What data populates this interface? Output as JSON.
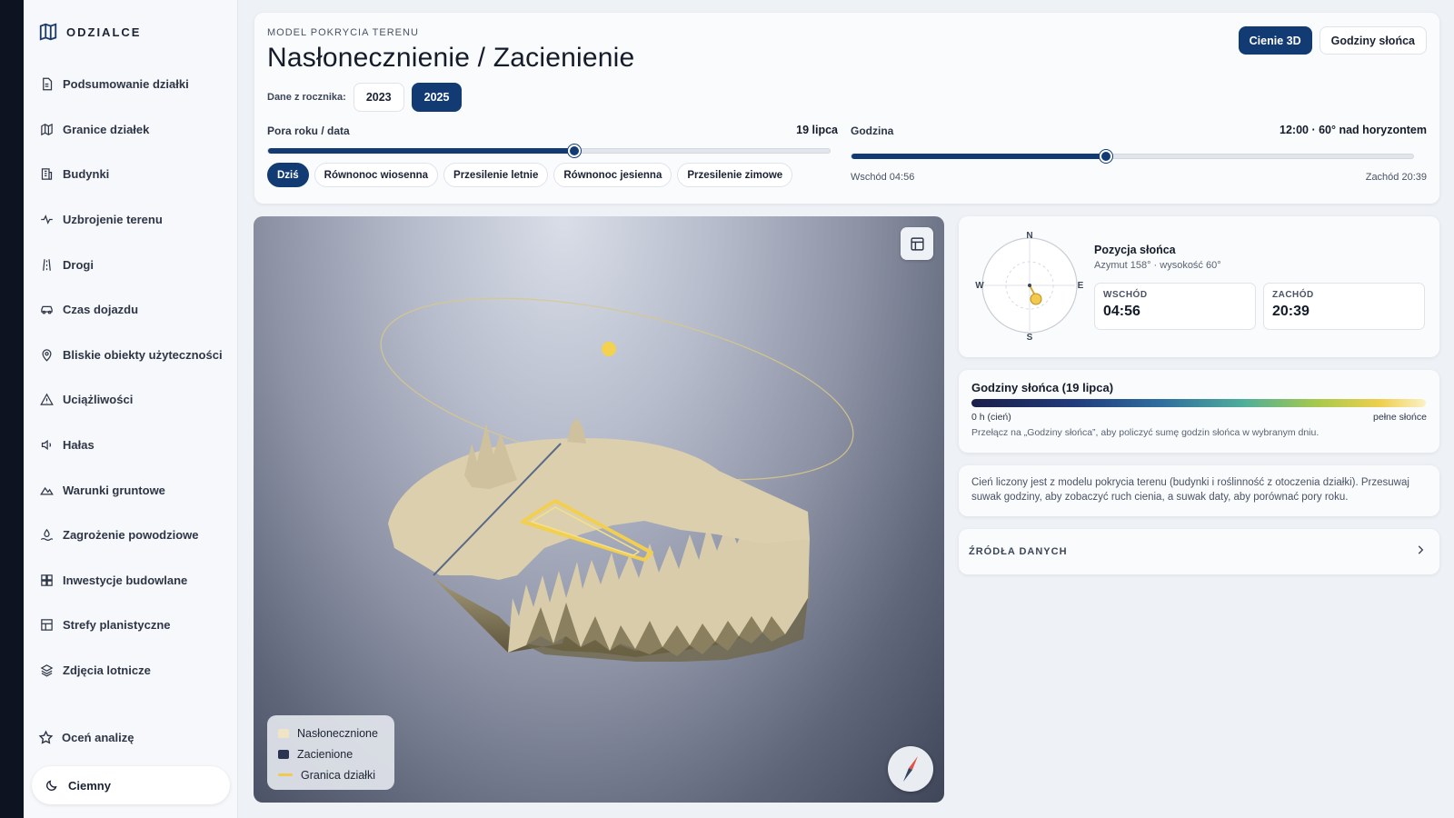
{
  "brand": {
    "name": "ODZIALCE"
  },
  "sidebar": {
    "items": [
      {
        "label": "Podsumowanie działki",
        "icon": "document-icon"
      },
      {
        "label": "Granice działek",
        "icon": "map-icon"
      },
      {
        "label": "Budynki",
        "icon": "building-icon"
      },
      {
        "label": "Uzbrojenie terenu",
        "icon": "pulse-icon"
      },
      {
        "label": "Drogi",
        "icon": "road-icon"
      },
      {
        "label": "Czas dojazdu",
        "icon": "car-icon"
      },
      {
        "label": "Bliskie obiekty użyteczności",
        "icon": "location-pin-icon"
      },
      {
        "label": "Uciążliwości",
        "icon": "warning-icon"
      },
      {
        "label": "Hałas",
        "icon": "speaker-icon"
      },
      {
        "label": "Warunki gruntowe",
        "icon": "terrain-icon"
      },
      {
        "label": "Zagrożenie powodziowe",
        "icon": "flood-icon"
      },
      {
        "label": "Inwestycje budowlane",
        "icon": "grid-icon"
      },
      {
        "label": "Strefy planistyczne",
        "icon": "zones-icon"
      },
      {
        "label": "Zdjęcia lotnicze",
        "icon": "layers-icon"
      }
    ],
    "rate_label": "Oceń analizę",
    "theme_label": "Ciemny"
  },
  "header": {
    "eyebrow": "MODEL POKRYCIA TERENU",
    "title": "Nasłonecznienie / Zacienienie",
    "actions": {
      "shadows_3d": "Cienie 3D",
      "sun_hours": "Godziny słońca"
    },
    "years_label": "Dane z rocznika:",
    "years": [
      "2023",
      "2025"
    ],
    "active_year": "2025",
    "date_slider": {
      "label": "Pora roku / data",
      "value": "19 lipca",
      "fraction": 0.545
    },
    "time_slider": {
      "label": "Godzina",
      "value": "12:00 · 60° nad horyzontem",
      "fraction": 0.453,
      "start": "Wschód 04:56",
      "end": "Zachód 20:39"
    },
    "chips": [
      "Dziś",
      "Równonoc wiosenna",
      "Przesilenie letnie",
      "Równonoc jesienna",
      "Przesilenie zimowe"
    ],
    "active_chip": "Dziś"
  },
  "map": {
    "legend": [
      {
        "label": "Nasłonecznione",
        "color": "#efe4c6"
      },
      {
        "label": "Zacienione",
        "color": "#2b3352"
      },
      {
        "label": "Granica działki",
        "color": "#f2c94c"
      }
    ]
  },
  "sun": {
    "compass": {
      "n": "N",
      "e": "E",
      "s": "S",
      "w": "W"
    },
    "title": "Pozycja słońca",
    "subtitle": "Azymut 158° · wysokość 60°",
    "sunrise_label": "WSCHÓD",
    "sunrise_value": "04:56",
    "sunset_label": "ZACHÓD",
    "sunset_value": "20:39"
  },
  "hours": {
    "title": "Godziny słońca (19 lipca)",
    "min_label": "0 h (cień)",
    "max_label": "pełne słońce",
    "note": "Przełącz na „Godziny słońca”, aby policzyć sumę godzin słońca w wybranym dniu."
  },
  "info": {
    "text": "Cień liczony jest z modelu pokrycia terenu (budynki i roślinność z otoczenia działki). Przesuwaj suwak godziny, aby zobaczyć ruch cienia, a suwak daty, aby porównać pory roku."
  },
  "sources": {
    "label": "ŹRÓDŁA DANYCH"
  },
  "colors": {
    "primary": "#123b73",
    "sun": "#f2c94c"
  }
}
